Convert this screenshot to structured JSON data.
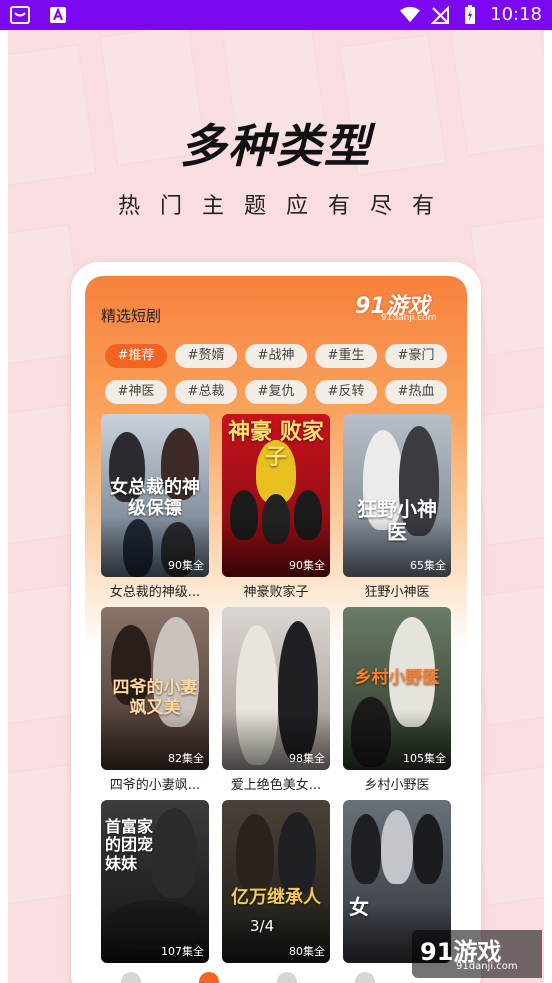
{
  "status_bar": {
    "time": "10:18",
    "icons": [
      "notification-icon",
      "font-a-icon",
      "wifi-icon",
      "no-sim-icon",
      "battery-charging-icon"
    ]
  },
  "hero": {
    "title": "多种类型",
    "subtitle": "热门主题应有尽有"
  },
  "app_screen": {
    "section_title": "精选短剧",
    "brand_logo_text": "91游戏",
    "brand_logo_sub": "91danji.com",
    "tags": [
      {
        "label": "#推荐",
        "active": true
      },
      {
        "label": "#赘婿",
        "active": false
      },
      {
        "label": "#战神",
        "active": false
      },
      {
        "label": "#重生",
        "active": false
      },
      {
        "label": "#豪门",
        "active": false
      },
      {
        "label": "#神医",
        "active": false
      },
      {
        "label": "#总裁",
        "active": false
      },
      {
        "label": "#复仇",
        "active": false
      },
      {
        "label": "#反转",
        "active": false
      },
      {
        "label": "#热血",
        "active": false
      }
    ],
    "dramas": [
      {
        "title": "女总裁的神级...",
        "episodes": "90集全",
        "poster_text": "女总裁的神级保镖",
        "bg": "#5b6b7c"
      },
      {
        "title": "神豪败家子",
        "episodes": "90集全",
        "poster_text": "神豪 败家子",
        "bg": "#b3161c"
      },
      {
        "title": "狂野小神医",
        "episodes": "65集全",
        "poster_text": "狂野小神医",
        "bg": "#7f8a96"
      },
      {
        "title": "四爷的小妻飒...",
        "episodes": "82集全",
        "poster_text": "四爷的小妻飒又美",
        "bg": "#5a4640"
      },
      {
        "title": "爱上绝色美女...",
        "episodes": "98集全",
        "poster_text": "",
        "bg": "#8a8280"
      },
      {
        "title": "乡村小野医",
        "episodes": "105集全",
        "poster_text": "乡村小野医",
        "bg": "#3c4b3c"
      },
      {
        "title": "",
        "episodes": "107集全",
        "poster_text": "首富家的团宠妹妹",
        "bg": "#2a2a2a"
      },
      {
        "title": "",
        "episodes": "80集全",
        "poster_text": "亿万继承人",
        "bg": "#39342c"
      },
      {
        "title": "",
        "episodes": "",
        "poster_text": "女",
        "bg": "#52575c"
      }
    ],
    "pager": "3/4"
  },
  "watermark": {
    "main": "91游戏",
    "sub": "91danji.com"
  },
  "colors": {
    "status_bar": "#7c08f2",
    "accent_orange": "#f46420",
    "page_bg": "#f9dde0"
  }
}
